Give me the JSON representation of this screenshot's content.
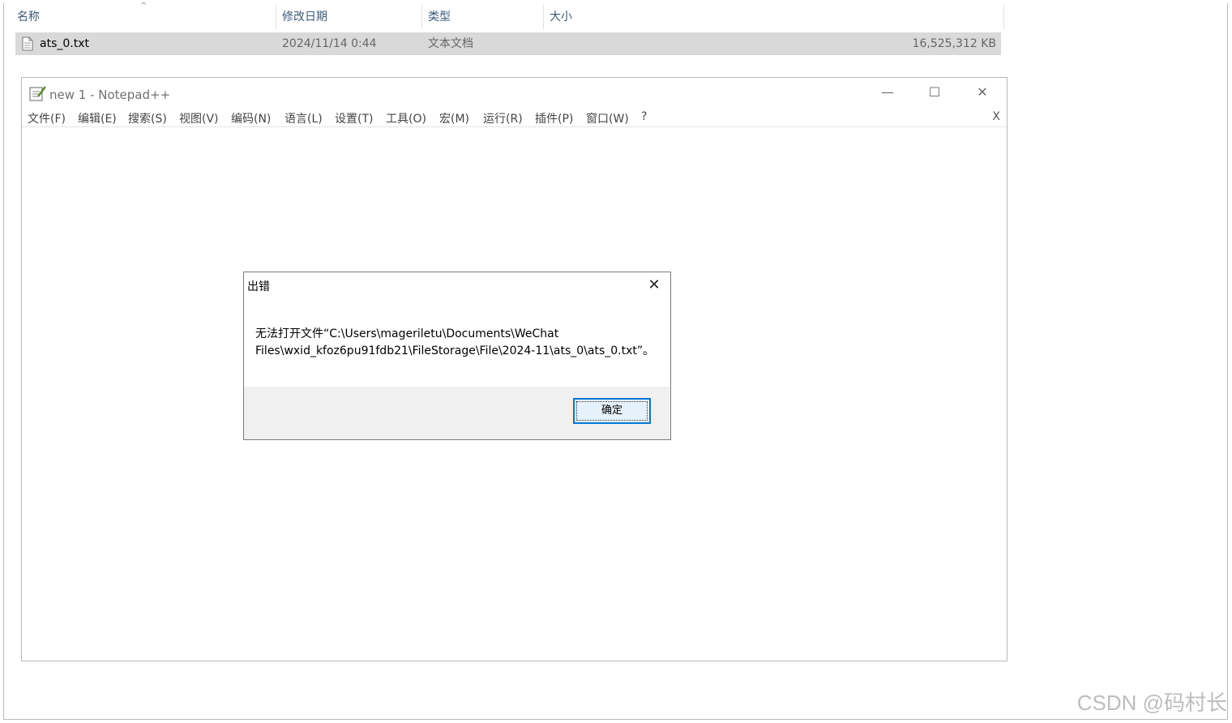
{
  "explorer": {
    "columns": {
      "name": "名称",
      "modified": "修改日期",
      "type": "类型",
      "size": "大小"
    },
    "file": {
      "name": "ats_0.txt",
      "modified": "2024/11/14 0:44",
      "type": "文本文档",
      "size": "16,525,312 KB"
    }
  },
  "notepad": {
    "title": "new 1 - Notepad++",
    "controls": {
      "minimize": "—",
      "maximize": "☐",
      "close": "✕"
    },
    "menu": [
      "文件(F)",
      "编辑(E)",
      "搜索(S)",
      "视图(V)",
      "编码(N)",
      "语言(L)",
      "设置(T)",
      "工具(O)",
      "宏(M)",
      "运行(R)",
      "插件(P)",
      "窗口(W)",
      "?"
    ],
    "close_doc": "X"
  },
  "dialog": {
    "title": "出错",
    "close": "✕",
    "message_line1": "无法打开文件“C:\\Users\\mageriletu\\Documents\\WeChat",
    "message_line2": "Files\\wxid_kfoz6pu91fdb21\\FileStorage\\File\\2024-11\\ats_0\\ats_0.txt”。",
    "ok_label": "确定"
  },
  "watermark": "CSDN @码村长"
}
